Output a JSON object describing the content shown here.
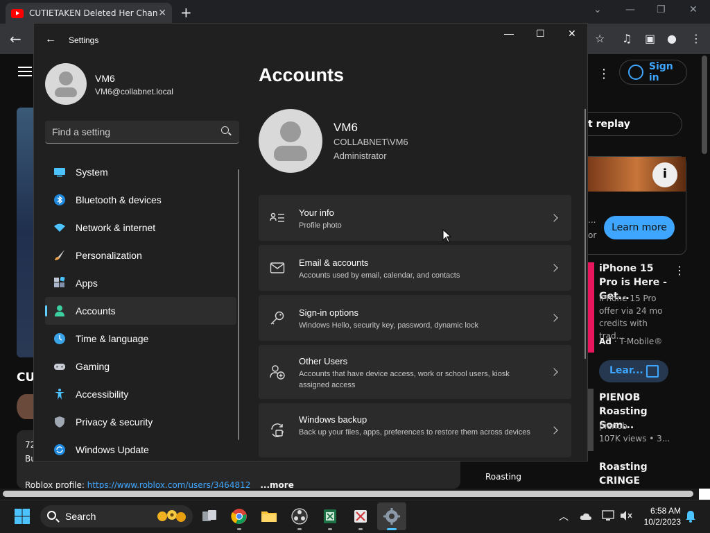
{
  "browser": {
    "tab_title": "CUTIETAKEN Deleted Her Chann",
    "tab_close": "✕",
    "new_tab": "+",
    "win_min": "—",
    "win_restore": "❐",
    "win_close": "✕"
  },
  "youtube": {
    "sign_in": "Sign in",
    "replay_partial": "t replay",
    "learn_more": "Learn more",
    "ad_partial_left": "...",
    "ad_partial_or": "or",
    "channel_partial": "CU",
    "desc_line1": "72",
    "desc_line2": "Bu",
    "desc_profile_label": "Roblox profile: ",
    "desc_profile_link": "https://www.roblox.com/users/3464812",
    "desc_more": "...more",
    "promo_title": "iPhone 15 Pro is Here - Get...",
    "promo_desc": "iPhone 15 Pro offer via 24 mo credits with trad...",
    "promo_ad": "Ad",
    "promo_advertiser": " · T-Mobile®",
    "learn_small": "Lear...",
    "video1_title": "PIENOB Roasting Som...",
    "video1_channel": "pienob",
    "video1_views": "107K views  • 3...",
    "video2_title": "Roasting CRINGE Video...",
    "thumb_label": "Roasting"
  },
  "settings": {
    "app_title": "Settings",
    "user_name": "VM6",
    "user_email": "VM6@collabnet.local",
    "search_placeholder": "Find a setting",
    "nav": [
      {
        "label": "System"
      },
      {
        "label": "Bluetooth & devices"
      },
      {
        "label": "Network & internet"
      },
      {
        "label": "Personalization"
      },
      {
        "label": "Apps"
      },
      {
        "label": "Accounts"
      },
      {
        "label": "Time & language"
      },
      {
        "label": "Gaming"
      },
      {
        "label": "Accessibility"
      },
      {
        "label": "Privacy & security"
      },
      {
        "label": "Windows Update"
      }
    ],
    "active_nav": "Accounts",
    "page_title": "Accounts",
    "account": {
      "name": "VM6",
      "domain": "COLLABNET\\VM6",
      "role": "Administrator"
    },
    "cards": [
      {
        "title": "Your info",
        "desc": "Profile photo"
      },
      {
        "title": "Email & accounts",
        "desc": "Accounts used by email, calendar, and contacts"
      },
      {
        "title": "Sign-in options",
        "desc": "Windows Hello, security key, password, dynamic lock"
      },
      {
        "title": "Other Users",
        "desc": "Accounts that have device access, work or school users, kiosk assigned access"
      },
      {
        "title": "Windows backup",
        "desc": "Back up your files, apps, preferences to restore them across devices"
      }
    ]
  },
  "taskbar": {
    "search_label": "Search",
    "time": "6:58 AM",
    "date": "10/2/2023"
  },
  "colors": {
    "accent": "#60cdff",
    "yt_blue": "#3ea6ff"
  }
}
